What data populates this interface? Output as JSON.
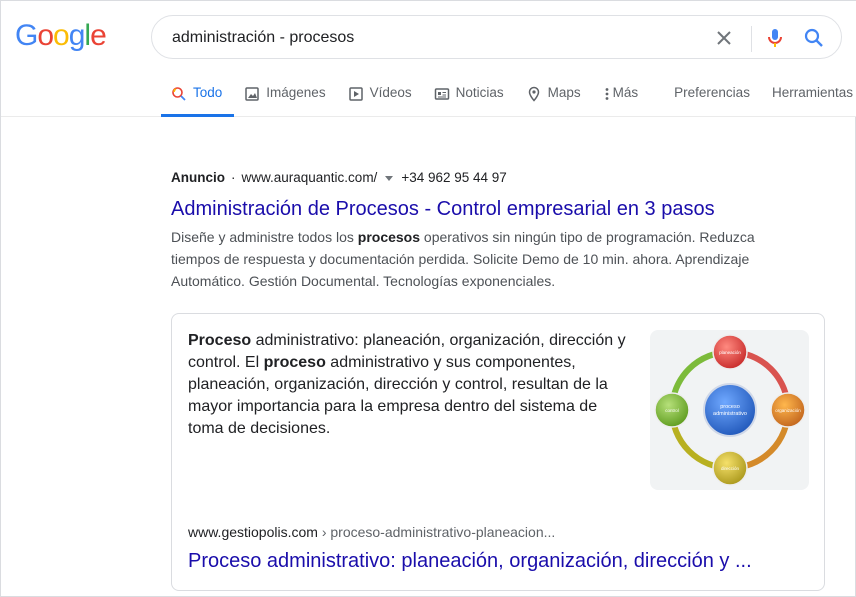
{
  "logo": {
    "letters": [
      "G",
      "o",
      "o",
      "g",
      "l",
      "e"
    ]
  },
  "search": {
    "query": "administración - procesos"
  },
  "tabs": [
    {
      "label": "Todo",
      "icon": "search-icon",
      "active": true
    },
    {
      "label": "Imágenes",
      "icon": "image-icon"
    },
    {
      "label": "Vídeos",
      "icon": "video-icon"
    },
    {
      "label": "Noticias",
      "icon": "news-icon"
    },
    {
      "label": "Maps",
      "icon": "map-pin-icon"
    },
    {
      "label": "Más",
      "icon": "more-vertical-icon"
    },
    {
      "label": "Preferencias"
    },
    {
      "label": "Herramientas"
    }
  ],
  "ad": {
    "label": "Anuncio",
    "separator": "·",
    "url": "www.auraquantic.com/",
    "phone": "+34 962 95 44 97",
    "title": "Administración de Procesos - Control empresarial en 3 pasos",
    "desc_before": "Diseñe y administre todos los ",
    "desc_bold": "procesos",
    "desc_after": " operativos sin ningún tipo de programación. Reduzca tiempos de respuesta y documentación perdida. Solicite Demo de 10 min. ahora. Aprendizaje Automático. Gestión Documental. Tecnologías exponenciales."
  },
  "snippet": {
    "bold1": "Proceso",
    "text1": " administrativo: planeación, organización, dirección y control. El ",
    "bold2": "proceso",
    "text2": " administrativo y sus componentes, planeación, organización, dirección y control, resultan de la mayor importancia para la empresa dentro del sistema de toma de decisiones.",
    "cite_domain": "www.gestiopolis.com",
    "cite_path": " › proceso-administrativo-planeacion...",
    "link": "Proceso administrativo: planeación, organización, dirección y ...",
    "image": {
      "center_label": "proceso administrativo",
      "nodes": [
        "planeación",
        "organización",
        "dirección",
        "control"
      ]
    }
  },
  "colors": {
    "link": "#1a0dab",
    "accent": "#1a73e8",
    "google_blue": "#4285f4",
    "google_red": "#ea4335",
    "google_yellow": "#fbbc05",
    "google_green": "#34a853"
  }
}
